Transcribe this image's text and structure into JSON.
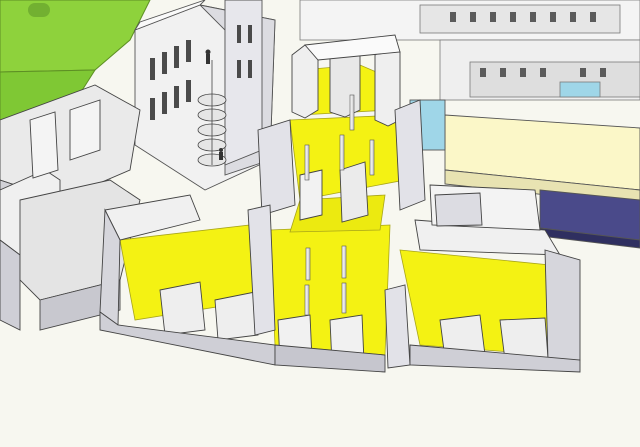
{
  "scene": {
    "kind": "3d-architectural-model",
    "view": "aerial-isometric",
    "colors": {
      "ground": "#f7f7f0",
      "lawn": "#8ed23c",
      "lawn_dark": "#6fb02a",
      "highlight_floor": "#f4f213",
      "highlight_floor_dark": "#d9d60d",
      "wall_top": "#f3f3f3",
      "wall_side": "#d9d9de",
      "wall_shade": "#b9b9c2",
      "outline": "#3a3a3a",
      "roof_band": "#fbf7c8",
      "facade_dark": "#4a4a8a",
      "glass": "#9fd6e8"
    }
  }
}
